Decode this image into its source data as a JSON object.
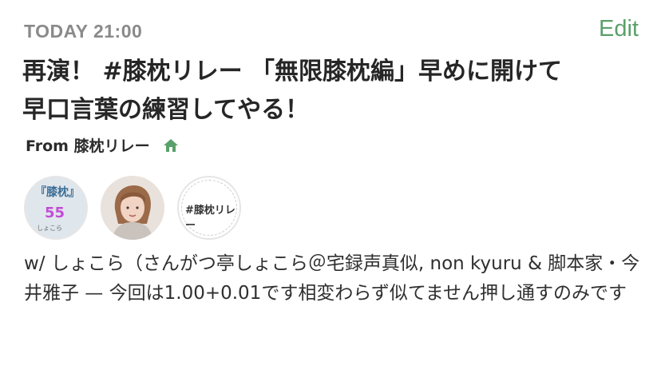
{
  "header": {
    "time": "TODAY 21:00",
    "edit_label": "Edit"
  },
  "event": {
    "title": "再演！ #膝枕リレー 「無限膝枕編」早めに開けて早口言葉の練習してやる！",
    "from_label": "From 膝枕リレー",
    "description": "w/ しょこら（さんがつ亭しょこら＠宅録声真似, non kyuru & 脚本家・今井雅子 — 今回は1.00+0.01です相変わらず似てません押し通すのみです"
  },
  "avatars": {
    "av1": {
      "line1": "『膝枕』",
      "line2": "55",
      "line3": "しょこら"
    },
    "av3": {
      "label": "#膝枕リレー"
    }
  },
  "colors": {
    "accent": "#5aa06a",
    "timestamp": "#8a8a8a",
    "text": "#2b2b2b"
  },
  "icons": {
    "home": "home-icon"
  }
}
